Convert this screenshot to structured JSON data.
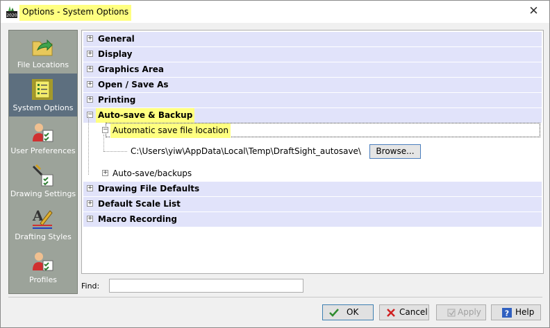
{
  "window": {
    "title": "Options - System Options",
    "close_glyph": "✕"
  },
  "sidebar": {
    "items": [
      {
        "label": "File Locations",
        "icon": "folder-arrow-icon"
      },
      {
        "label": "System Options",
        "icon": "checklist-icon",
        "active": true
      },
      {
        "label": "User Preferences",
        "icon": "user-preferences-icon"
      },
      {
        "label": "Drawing Settings",
        "icon": "drawing-settings-icon"
      },
      {
        "label": "Drafting Styles",
        "icon": "drafting-styles-icon"
      },
      {
        "label": "Profiles",
        "icon": "profiles-icon"
      }
    ]
  },
  "tree": {
    "nodes": [
      {
        "label": "General",
        "state": "collapsed"
      },
      {
        "label": "Display",
        "state": "collapsed"
      },
      {
        "label": "Graphics Area",
        "state": "collapsed"
      },
      {
        "label": "Open / Save As",
        "state": "collapsed"
      },
      {
        "label": "Printing",
        "state": "collapsed"
      },
      {
        "label": "Auto-save & Backup",
        "state": "expanded"
      },
      {
        "label": "Automatic save file location",
        "state": "expanded"
      },
      {
        "label": "C:\\Users\\yiw\\AppData\\Local\\Temp\\DraftSight_autosave\\"
      },
      {
        "label": "Auto-save/backups",
        "state": "collapsed"
      },
      {
        "label": "Drawing File Defaults",
        "state": "collapsed"
      },
      {
        "label": "Default Scale List",
        "state": "collapsed"
      },
      {
        "label": "Macro Recording",
        "state": "collapsed"
      }
    ],
    "browse_label": "Browse...",
    "expand_glyph": "+",
    "collapse_glyph": "−"
  },
  "find": {
    "label": "Find:",
    "value": ""
  },
  "buttons": {
    "ok": "OK",
    "cancel": "Cancel",
    "apply": "Apply",
    "help": "Help"
  }
}
